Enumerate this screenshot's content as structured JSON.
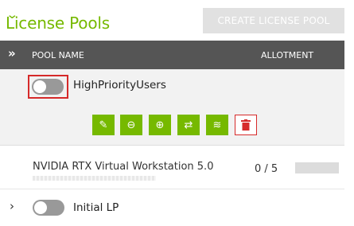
{
  "header": {
    "title": "License Pools",
    "create_button": "CREATE LICENSE POOL"
  },
  "table": {
    "expand_all_icon": "double-chevron-right-icon",
    "columns": [
      "POOL NAME",
      "ALLOTMENT"
    ]
  },
  "pools": [
    {
      "name": "HighPriorityUsers",
      "expanded": true,
      "enabled": false,
      "actions": [
        {
          "name": "edit",
          "icon": "pencil-icon",
          "glyph": "✎"
        },
        {
          "name": "remove-licenses",
          "icon": "minus-circle-icon",
          "glyph": "⊖"
        },
        {
          "name": "add-licenses",
          "icon": "plus-circle-icon",
          "glyph": "⊕"
        },
        {
          "name": "transfer",
          "icon": "transfer-arrows-icon",
          "glyph": "⇄"
        },
        {
          "name": "layers",
          "icon": "layers-icon",
          "glyph": "≋"
        },
        {
          "name": "delete",
          "icon": "trash-icon",
          "glyph": "🗑"
        }
      ],
      "licenses": [
        {
          "feature": "NVIDIA RTX Virtual Workstation 5.0",
          "allotment": "0 / 5"
        }
      ]
    },
    {
      "name": "Initial LP",
      "expanded": false,
      "enabled": false
    }
  ],
  "colors": {
    "accent": "#76b900",
    "header_bg": "#555555",
    "danger": "#d62a2a",
    "disabled_button": "#e1e1e1"
  }
}
